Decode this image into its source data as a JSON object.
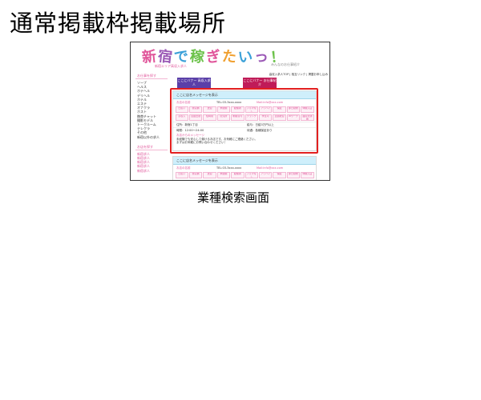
{
  "page": {
    "title": "通常掲載枠掲載場所",
    "caption": "業種検索画面"
  },
  "screenshot": {
    "logo": {
      "chars": [
        {
          "c": "新",
          "color": "#e0559a"
        },
        {
          "c": "宿",
          "color": "#9b59b6"
        },
        {
          "c": "で",
          "color": "#3aa0d8"
        },
        {
          "c": "稼",
          "color": "#6cc24a"
        },
        {
          "c": "ぎ",
          "color": "#e0559a"
        },
        {
          "c": "た",
          "color": "#f0a030"
        },
        {
          "c": "い",
          "color": "#3aa0d8"
        },
        {
          "c": "っ",
          "color": "#9b59b6"
        },
        {
          "c": "！",
          "color": "#6cc24a"
        }
      ],
      "sub": "新宿エリア高収入求人",
      "sub2": "みんなのお仕事紹介"
    },
    "top_links": "高収入求人TOP | 相互リンク | 掲載お申し込み",
    "sidebar": {
      "head1": "お仕事を探す",
      "items": [
        "ソープ",
        "ヘルス",
        "ホテヘル",
        "デリヘル",
        "ホテル",
        "エステ",
        "オナクラ",
        "ホスト",
        "携帯チャット",
        "撮影モデル",
        "トークルーム",
        "テレクラ",
        "その他",
        "新宿以外の求人"
      ],
      "head2": "お店を探す",
      "items2": [
        "新宿求人",
        "新宿求人",
        "新宿求人",
        "新宿求人",
        "新宿求人"
      ]
    },
    "banners": [
      {
        "text": "ここにバナー 高収入求人"
      },
      {
        "text": "ここにバナー お仕事紹介"
      }
    ],
    "listing1": {
      "title": "ここに店名メッセージを表示",
      "shop": "お店の名前",
      "tel": "TEL:03-3xxx-xxxx",
      "mail": "Mail:info@xxx.com",
      "tags_row1": [
        "日払い",
        "寮完備",
        "送迎",
        "未経験",
        "経験者",
        "ノルマなし",
        "アリバイ",
        "保証",
        "即日勤務",
        "体験入店"
      ],
      "tags_row2": [
        "高収入",
        "自由出勤",
        "短時間",
        "託児所",
        "制服貸与",
        "ブランク",
        "学生可",
        "主婦歓迎",
        "Wワーク",
        "面接交通費"
      ],
      "info_left": "住所：新宿1丁目",
      "info_right": "給与：日給3万円以上",
      "info2_left": "時間：12:00～24:00",
      "info2_right": "待遇：各種保証あり",
      "note_head": "お店からのメッセージ",
      "note1": "未経験でも安心して働けるお店です。お気軽にご連絡ください。",
      "note2": "まずはお気軽にお問い合わせください！"
    },
    "listing2": {
      "title": "ここに店名メッセージを表示",
      "shop": "お店の名前",
      "tel": "TEL:03-3xxx-xxxx",
      "mail": "Mail:info@xxx.com",
      "tags_row1": [
        "日払い",
        "寮完備",
        "送迎",
        "未経験",
        "経験者",
        "ノルマなし",
        "アリバイ",
        "保証",
        "即日勤務",
        "体験入店"
      ]
    },
    "highlight_color": "#e32020",
    "accent_color": "#e0559a"
  }
}
